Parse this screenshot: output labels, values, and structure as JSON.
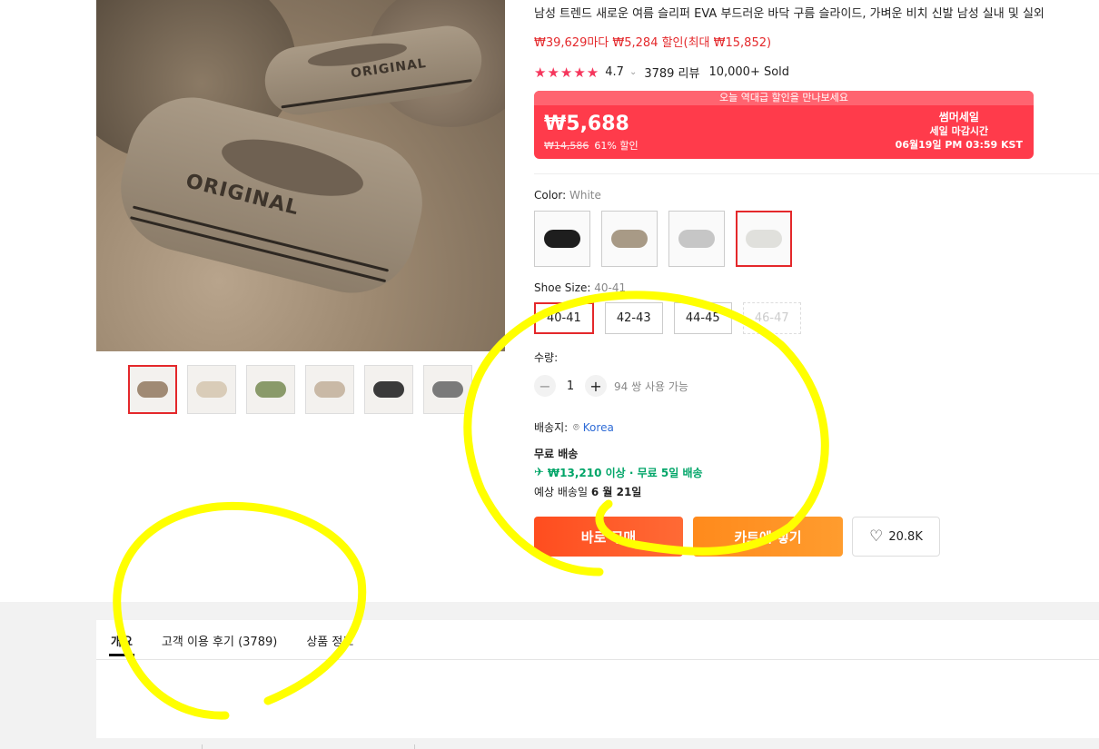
{
  "product": {
    "title": "남성 트렌드 새로운 여름 슬리퍼 EVA 부드러운 바닥 구름 슬라이드, 가벼운 비치 신발 남성 실내 및 실외",
    "promo": "₩39,629마다 ₩5,284 할인(최대 ₩15,852)",
    "stars": "★★★★★",
    "rating": "4.7",
    "rating_chevron": "⌄",
    "reviews": "3789 리뷰",
    "sold": "10,000+ Sold"
  },
  "images": {
    "main_text_1": "ORIGINAL",
    "main_text_2": "ORIGINAL",
    "thumb_colors": [
      "#a08a74",
      "#d9ccb8",
      "#8a9a6a",
      "#c9b9a6",
      "#3a3a3a",
      "#7a7a7a"
    ]
  },
  "deal": {
    "banner": "오늘 역대급 할인을 만나보세요",
    "price": "₩5,688",
    "original": "₩14,586",
    "discount": "61% 할인",
    "sale_name": "썸머세일",
    "sale_deadline": "세일 마감시간",
    "sale_time": "06월19일 PM 03:59 KST"
  },
  "color": {
    "label": "Color: ",
    "value": "White",
    "options": [
      "#1e1e1e",
      "#a89a86",
      "#c6c6c6",
      "#e0e0dc"
    ]
  },
  "size": {
    "label": "Shoe Size: ",
    "value": "40-41",
    "options": [
      "40-41",
      "42-43",
      "44-45",
      "46-47"
    ]
  },
  "quantity": {
    "label": "수량:",
    "minus": "−",
    "plus": "+",
    "value": "1",
    "available": "94 쌍 사용 가능"
  },
  "shipping": {
    "ship_to_label": "배송지:",
    "pin_icon": "⌾",
    "location": "Korea",
    "free_title": "무료 배송",
    "plane_icon": "✈",
    "free_info": "₩13,210 이상 · 무료 5일 배송",
    "eta_label": "예상 배송일 ",
    "eta_date": "6 월 21일"
  },
  "actions": {
    "buy": "바로 구매",
    "cart": "카트에 넣기",
    "heart_icon": "♡",
    "wishlist_count": "20.8K"
  },
  "tabs": [
    "개요",
    "고객 이용 후기 (3789)",
    "상품 정보"
  ],
  "annotation_color": "#ffff00"
}
